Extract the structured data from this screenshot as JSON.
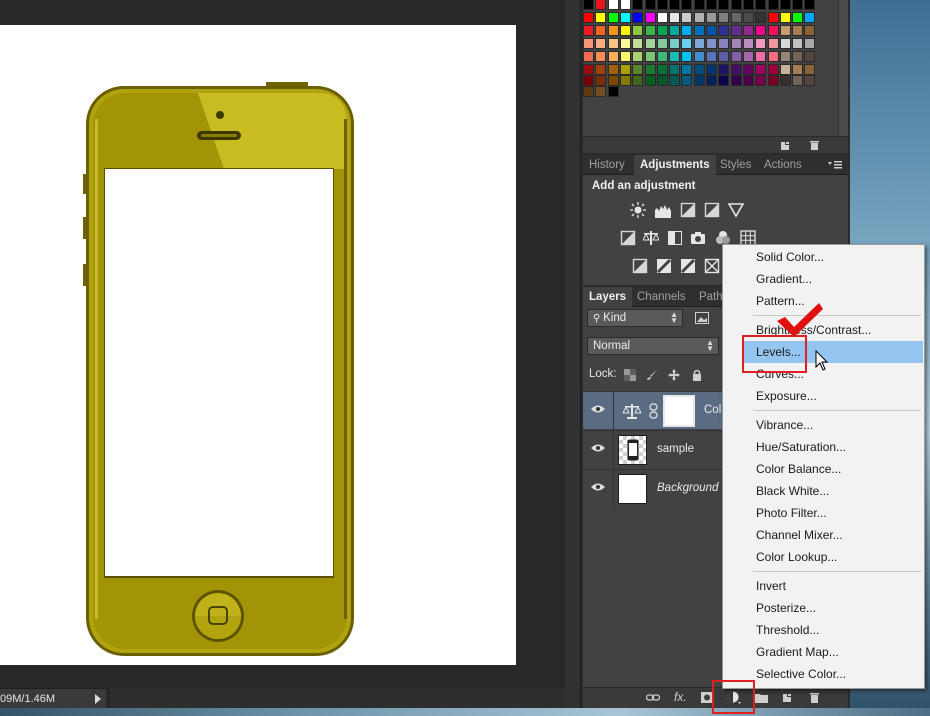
{
  "status": {
    "doc_size": "09M/1.46M"
  },
  "swatches": {
    "rows": [
      [
        "#000000",
        "#e8161b",
        "#ffffff",
        "#ffffff",
        "#000000",
        "#000000",
        "#000000",
        "#000000",
        "#000000",
        "#000000",
        "#000000",
        "#000000",
        "#000000",
        "#000000",
        "#000000",
        "#000000",
        "#000000",
        "#000000",
        "#000000"
      ],
      [
        "#ff0000",
        "#ffff00",
        "#00ff00",
        "#00ffff",
        "#0000ff",
        "#ff00ff",
        "#ffffff",
        "#e5e5e5",
        "#cccccc",
        "#b2b2b2",
        "#999999",
        "#7f7f7f",
        "#666666",
        "#4c4c4c",
        "#333333",
        "#ff0000",
        "#ffff00",
        "#00ff00",
        "#00a6ff"
      ],
      [
        "#ed1c24",
        "#f26522",
        "#f7941d",
        "#fff200",
        "#8dc63f",
        "#39b54a",
        "#00a651",
        "#00a99d",
        "#00aeef",
        "#0072bc",
        "#0054a6",
        "#2e3192",
        "#662d91",
        "#92278f",
        "#ec008c",
        "#ed145b",
        "#c69c6d",
        "#a67c52",
        "#8c6239"
      ],
      [
        "#f69679",
        "#f9ad81",
        "#fdc689",
        "#fff799",
        "#c4df9b",
        "#a3d39c",
        "#82ca9c",
        "#7accc8",
        "#6dcff6",
        "#7da7d9",
        "#8393ca",
        "#8781bd",
        "#a186be",
        "#bd8cbf",
        "#f49ac1",
        "#f5989d",
        "#d7d7d7",
        "#c2c2c2",
        "#a8a8a8"
      ],
      [
        "#f26c4f",
        "#f68e56",
        "#fbaf5d",
        "#fff568",
        "#acd373",
        "#7cc576",
        "#3cb878",
        "#1cbbb4",
        "#00bff3",
        "#448ccb",
        "#5574b9",
        "#605ca8",
        "#8560a8",
        "#a864a8",
        "#f06eaa",
        "#f26d7d",
        "#998675",
        "#736357",
        "#534741"
      ],
      [
        "#9e0b0f",
        "#a0410d",
        "#a36209",
        "#aba000",
        "#598527",
        "#197b30",
        "#007236",
        "#00746b",
        "#0076a3",
        "#004b80",
        "#003471",
        "#1b1464",
        "#440e62",
        "#630460",
        "#9e005d",
        "#9e0039",
        "#c7b299",
        "#a67c52",
        "#8c6239"
      ],
      [
        "#790000",
        "#7b2e00",
        "#7d4900",
        "#827b00",
        "#406618",
        "#005e20",
        "#005826",
        "#005952",
        "#005b7f",
        "#003663",
        "#002157",
        "#0d004c",
        "#32004b",
        "#4b0049",
        "#7b0046",
        "#7a0026",
        "#362f2d",
        "#736357",
        "#534741"
      ],
      [
        "#603913",
        "#754c24",
        "#000000"
      ]
    ]
  },
  "top_tabs": [
    {
      "label": "History",
      "active": false
    },
    {
      "label": "Adjustments",
      "active": true
    },
    {
      "label": "Styles",
      "active": false
    },
    {
      "label": "Actions",
      "active": false
    }
  ],
  "adjustments": {
    "title": "Add an adjustment",
    "icons": [
      "brightness-icon",
      "levels-icon",
      "curves-icon",
      "exposure-icon",
      "vibrance-icon",
      "hue-saturation-icon",
      "color-balance-icon",
      "black-white-icon",
      "photo-filter-icon",
      "channel-mixer-icon",
      "color-lookup-icon",
      "invert-icon",
      "posterize-icon",
      "threshold-icon",
      "gradient-map-icon"
    ]
  },
  "layer_tabs": [
    {
      "label": "Layers",
      "active": true
    },
    {
      "label": "Channels",
      "active": false
    },
    {
      "label": "Path",
      "active": false
    }
  ],
  "layers": {
    "filter_kind": "Kind",
    "blend_mode": "Normal",
    "lock_label": "Lock:",
    "rows": [
      {
        "name": "Col",
        "selected": true,
        "italic": false
      },
      {
        "name": "sample",
        "selected": false,
        "italic": false
      },
      {
        "name": "Background",
        "selected": false,
        "italic": true
      }
    ]
  },
  "menu": {
    "items": [
      {
        "label": "Solid Color...",
        "sep_after": false
      },
      {
        "label": "Gradient...",
        "sep_after": false
      },
      {
        "label": "Pattern...",
        "sep_after": true
      },
      {
        "label": "Brightness/Contrast...",
        "sep_after": false
      },
      {
        "label": "Levels...",
        "sep_after": false,
        "highlighted": true
      },
      {
        "label": "Curves...",
        "sep_after": false
      },
      {
        "label": "Exposure...",
        "sep_after": true
      },
      {
        "label": "Vibrance...",
        "sep_after": false
      },
      {
        "label": "Hue/Saturation...",
        "sep_after": false
      },
      {
        "label": "Color Balance...",
        "sep_after": false
      },
      {
        "label": "Black  White...",
        "sep_after": false
      },
      {
        "label": "Photo Filter...",
        "sep_after": false
      },
      {
        "label": "Channel Mixer...",
        "sep_after": false
      },
      {
        "label": "Color Lookup...",
        "sep_after": true
      },
      {
        "label": "Invert",
        "sep_after": false
      },
      {
        "label": "Posterize...",
        "sep_after": false
      },
      {
        "label": "Threshold...",
        "sep_after": false
      },
      {
        "label": "Gradient Map...",
        "sep_after": false
      },
      {
        "label": "Selective Color...",
        "sep_after": false
      }
    ]
  },
  "colors": {
    "menu_highlight": "#94c5f0",
    "annotation_red": "#e02020",
    "phone_gold": "#a89a05",
    "selected_layer": "#5a6b82"
  }
}
